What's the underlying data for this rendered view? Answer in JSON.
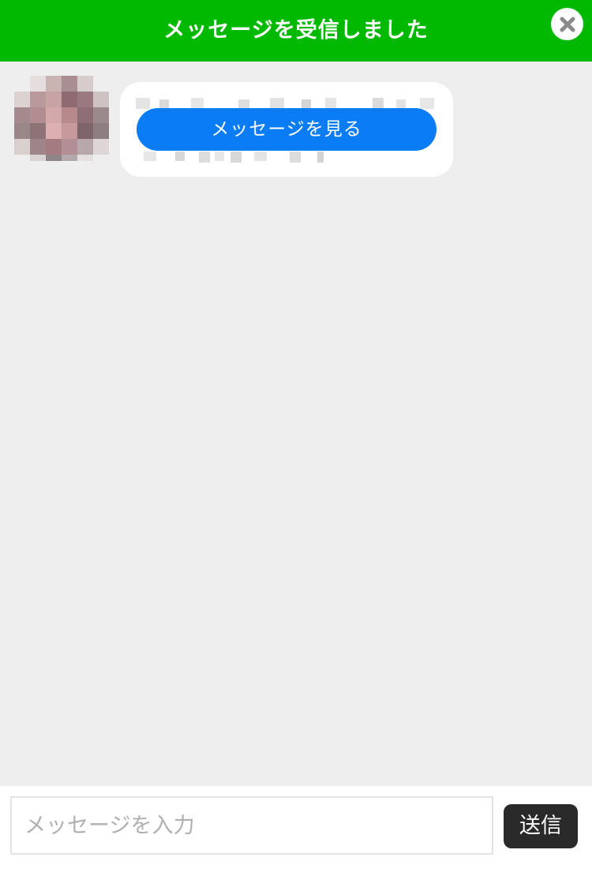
{
  "header": {
    "title": "メッセージを受信しました",
    "close_icon": "close-icon"
  },
  "chat": {
    "messages": [
      {
        "avatar": "avatar-image (pixelated)",
        "preview_text": "",
        "view_button_label": "メッセージを見る"
      }
    ]
  },
  "composer": {
    "placeholder": "メッセージを入力",
    "value": "",
    "send_label": "送信"
  },
  "colors": {
    "header_bg": "#00b900",
    "page_bg": "#eeeeee",
    "button_blue": "#0a7cf5",
    "send_bg": "#2a2a2a"
  }
}
